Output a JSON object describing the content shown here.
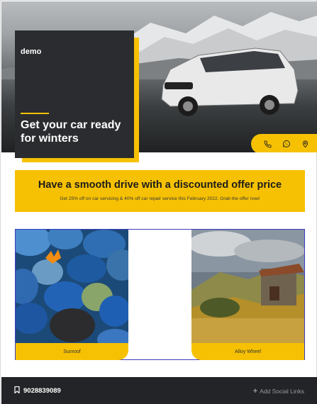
{
  "hero": {
    "brand": "demo",
    "title": "Get your car ready for winters",
    "icons": [
      "phone-icon",
      "whatsapp-icon",
      "location-pin-icon"
    ]
  },
  "offer": {
    "title": "Have a smooth drive with a discounted offer price",
    "description": "Get 25% off on car servicing & 40% off car repair service this February 2022. Grab the offer now!"
  },
  "gallery": {
    "items": [
      {
        "caption": "Sunroof"
      },
      {
        "caption": "Alloy Wheel"
      }
    ]
  },
  "footer": {
    "phone": "9028839089",
    "social_label": "Add Social Links",
    "social_prefix": "+"
  },
  "colors": {
    "accent": "#f6c103",
    "dark": "#2b2c2f",
    "footer": "#232427"
  }
}
